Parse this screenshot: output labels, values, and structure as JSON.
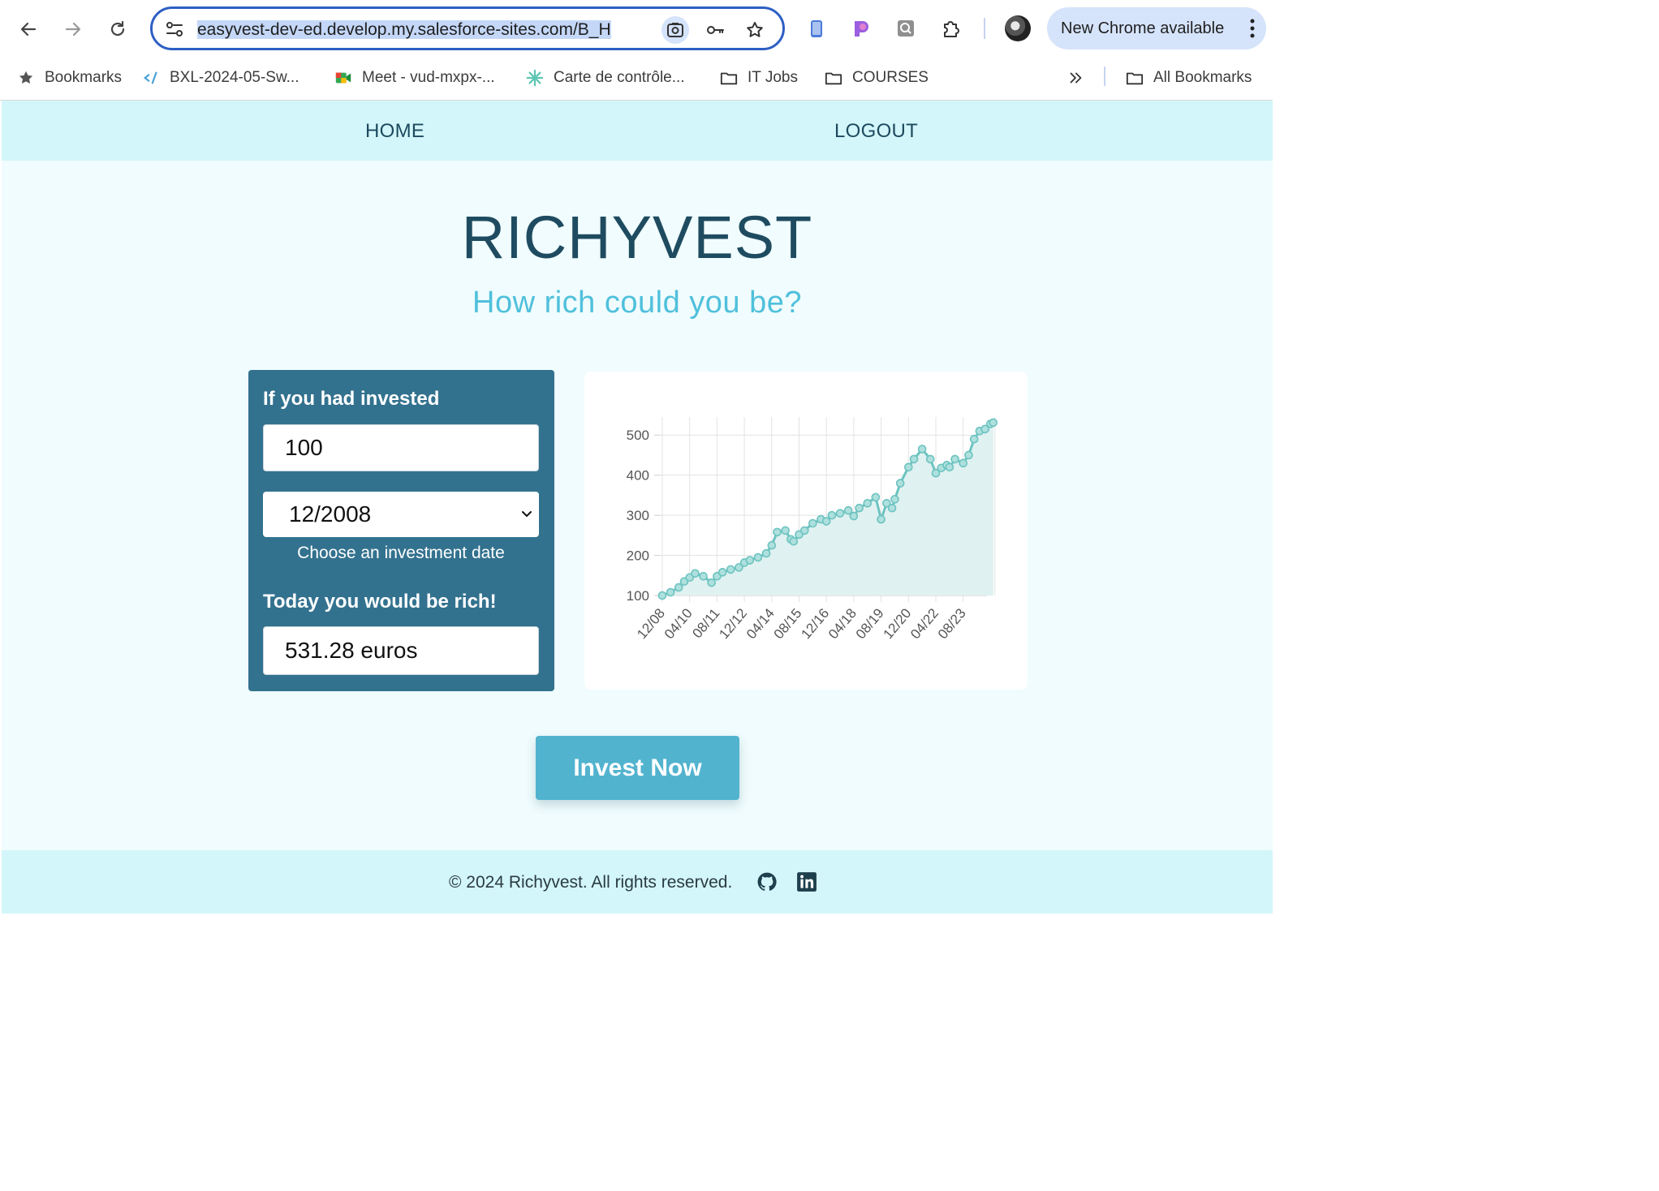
{
  "browser": {
    "url_text": "easyvest-dev-ed.develop.my.salesforce-sites.com/B_H",
    "update_label": "New Chrome available",
    "bookmarks": [
      {
        "label": "Bookmarks",
        "icon": "star-icon"
      },
      {
        "label": "BXL-2024-05-Sw...",
        "icon": "code-icon"
      },
      {
        "label": "Meet - vud-mxpx-...",
        "icon": "meet-icon"
      },
      {
        "label": "Carte de contrôle...",
        "icon": "snowflake-icon"
      },
      {
        "label": "IT Jobs",
        "icon": "folder-icon"
      },
      {
        "label": "COURSES",
        "icon": "folder-icon"
      }
    ],
    "all_bookmarks_label": "All Bookmarks"
  },
  "nav": {
    "home": "HOME",
    "logout": "LOGOUT"
  },
  "hero": {
    "title": "RICHYVEST",
    "subtitle": "How rich could you be?"
  },
  "calculator": {
    "invested_label": "If you had invested",
    "amount_value": "100",
    "date_value": "12/2008",
    "date_help": "Choose an investment date",
    "result_label": "Today you would be rich!",
    "result_value": "531.28 euros"
  },
  "button": {
    "invest_label": "Invest Now"
  },
  "footer": {
    "copyright": "© 2024 Richyvest. All rights reserved."
  },
  "colors": {
    "primary": "#33728f",
    "accent": "#52b3cf",
    "series": "#6cc3c0",
    "series_fill": "#dff1f0"
  },
  "chart_data": {
    "type": "area",
    "categories": [
      "12/08",
      "04/10",
      "08/11",
      "12/12",
      "04/14",
      "08/15",
      "12/16",
      "04/18",
      "08/19",
      "12/20",
      "04/22",
      "08/23"
    ],
    "yticks": [
      100,
      200,
      300,
      400,
      500
    ],
    "ylim": [
      100,
      545
    ],
    "x_last": 12.1,
    "series": [
      {
        "x": [
          0,
          0.3,
          0.6,
          0.8,
          1.0,
          1.2,
          1.5,
          1.8,
          2.0,
          2.2,
          2.5,
          2.8,
          3.0,
          3.2,
          3.5,
          3.8,
          4.0,
          4.2,
          4.5,
          4.7,
          4.8,
          5.0,
          5.2,
          5.5,
          5.8,
          6.0,
          6.2,
          6.5,
          6.8,
          7.0,
          7.2,
          7.5,
          7.8,
          8.0,
          8.2,
          8.4,
          8.5,
          8.7,
          9.0,
          9.2,
          9.5,
          9.8,
          10.0,
          10.2,
          10.4,
          10.5,
          10.7,
          11.0,
          11.2,
          11.4,
          11.6,
          11.8,
          12.0,
          12.1
        ],
        "values": [
          100,
          108,
          120,
          135,
          145,
          155,
          148,
          132,
          148,
          158,
          165,
          170,
          182,
          188,
          195,
          205,
          225,
          258,
          262,
          240,
          235,
          252,
          262,
          280,
          290,
          285,
          300,
          305,
          312,
          298,
          318,
          330,
          345,
          290,
          330,
          318,
          340,
          380,
          420,
          440,
          465,
          440,
          405,
          418,
          425,
          420,
          440,
          430,
          450,
          490,
          510,
          515,
          528,
          531
        ]
      }
    ]
  }
}
